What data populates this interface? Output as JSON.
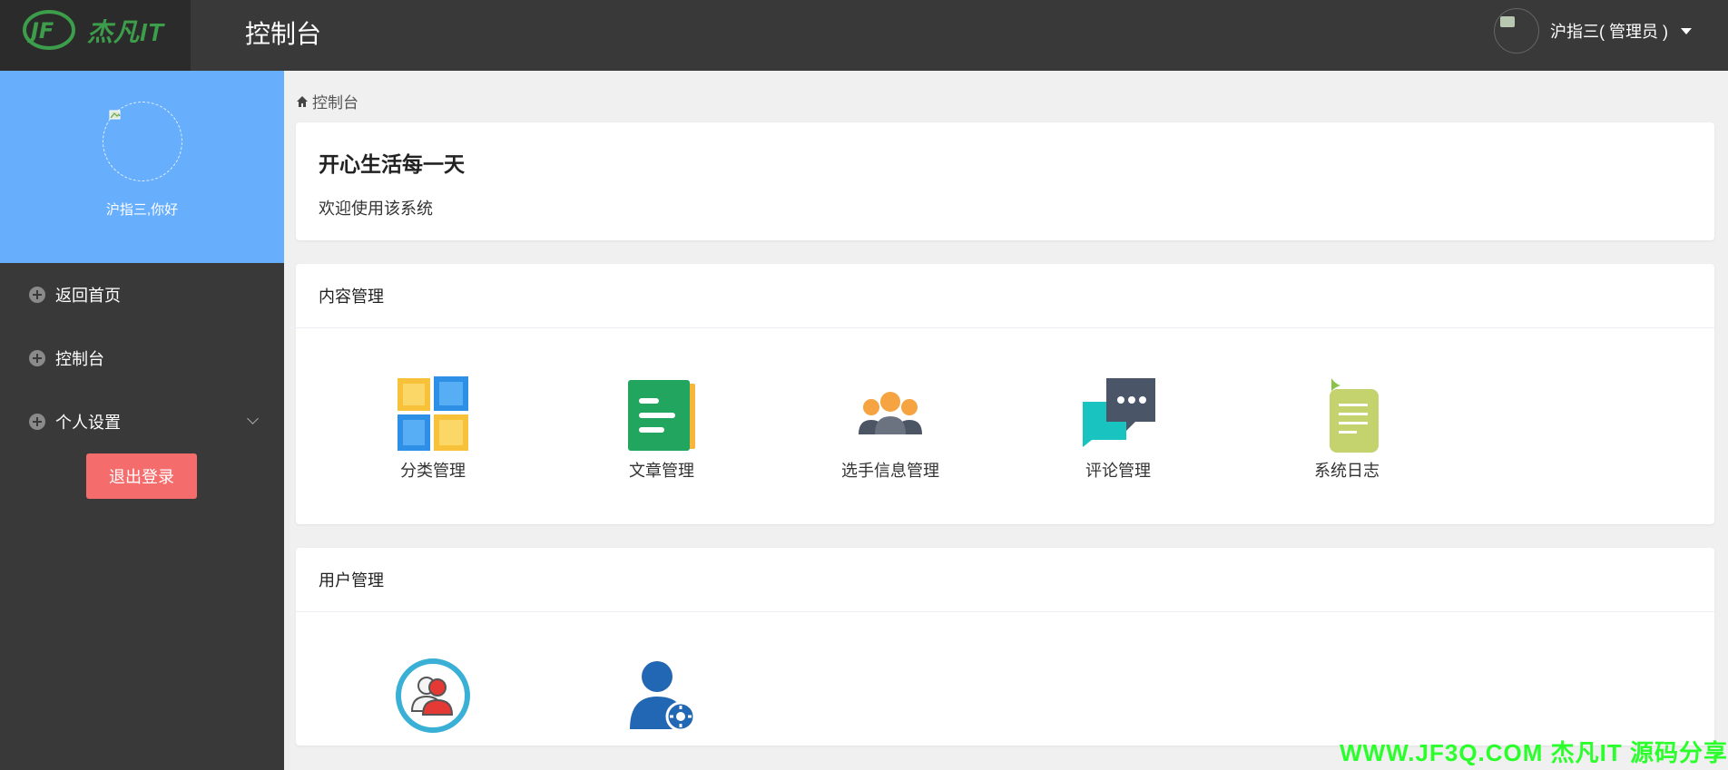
{
  "header": {
    "logo_text": "杰凡IT",
    "page_title": "控制台",
    "user_label": "沪指三( 管理员 )"
  },
  "sidebar": {
    "greeting": "沪指三,你好",
    "items": [
      {
        "label": "返回首页"
      },
      {
        "label": "控制台"
      },
      {
        "label": "个人设置"
      }
    ],
    "logout_label": "退出登录"
  },
  "breadcrumb": {
    "label": "控制台"
  },
  "welcome": {
    "title": "开心生活每一天",
    "text": "欢迎使用该系统"
  },
  "content_section": {
    "title": "内容管理",
    "tiles": [
      {
        "label": "分类管理",
        "icon": "blocks-icon"
      },
      {
        "label": "文章管理",
        "icon": "article-icon"
      },
      {
        "label": "选手信息管理",
        "icon": "group-icon"
      },
      {
        "label": "评论管理",
        "icon": "chat-icon"
      },
      {
        "label": "系统日志",
        "icon": "log-icon"
      }
    ]
  },
  "user_section": {
    "title": "用户管理",
    "tiles": [
      {
        "icon": "users-circle-icon"
      },
      {
        "icon": "user-gear-icon"
      }
    ]
  },
  "watermark": {
    "text": "WWW.JF3Q.COM 杰凡IT 源码分享"
  },
  "colors": {
    "topbar": "#393939",
    "sidebar": "#393939",
    "profile_bg": "#67aefc",
    "logout": "#f56c6c",
    "logo_green": "#3c9d4a"
  }
}
